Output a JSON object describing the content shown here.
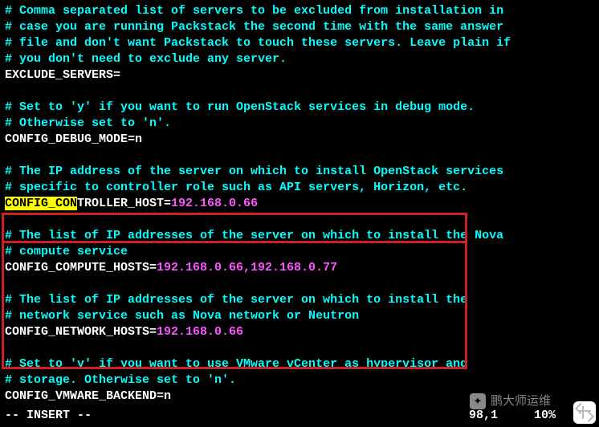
{
  "lines": {
    "c1": "# Comma separated list of servers to be excluded from installation in",
    "c2": "# case you are running Packstack the second time with the same answer",
    "c3": "# file and don't want Packstack to touch these servers. Leave plain if",
    "c4": "# you don't need to exclude any server.",
    "k1": "EXCLUDE_SERVERS=",
    "blank": "",
    "c5": "# Set to 'y' if you want to run OpenStack services in debug mode.",
    "c6": "# Otherwise set to 'n'.",
    "k2": "CONFIG_DEBUG_MODE=",
    "v2": "n",
    "c7": "# The IP address of the server on which to install OpenStack services",
    "c8": "# specific to controller role such as API servers, Horizon, etc.",
    "hi": "CONFIG_CON",
    "k3rest": "TROLLER_HOST=",
    "v3": "192.168.0.66",
    "c9": "# The list of IP addresses of the server on which to install the Nova",
    "c10": "# compute service",
    "k4": "CONFIG_COMPUTE_HOSTS=",
    "v4": "192.168.0.66,192.168.0.77",
    "c11": "# The list of IP addresses of the server on which to install the",
    "c12": "# network service such as Nova network or Neutron",
    "k5": "CONFIG_NETWORK_HOSTS=",
    "v5": "192.168.0.66",
    "c13": "# Set to 'y' if you want to use VMware vCenter as hypervisor and",
    "c14": "# storage. Otherwise set to 'n'.",
    "k6": "CONFIG_VMWARE_BACKEND=",
    "v6": "n"
  },
  "status": {
    "mode": "-- INSERT --",
    "position": "98,1",
    "percent": "10%"
  },
  "watermark": {
    "text": "鹏大师运维"
  }
}
